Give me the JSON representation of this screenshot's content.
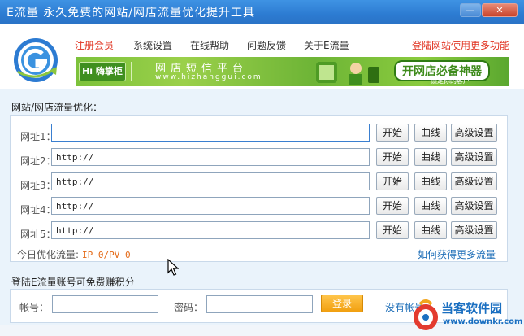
{
  "window": {
    "title": "E流量  永久免费的网站/网店流量优化提升工具",
    "minimize_label": "—",
    "close_label": "✕"
  },
  "menu": {
    "items": [
      "注册会员",
      "系统设置",
      "在线帮助",
      "问题反馈",
      "关于E流量"
    ],
    "right_link": "登陆网站使用更多功能"
  },
  "banner": {
    "logo_text": "Hi 嗨掌柜",
    "title": "网店短信平台",
    "url": "www.hizhanggui.com",
    "tag": "开网店必备神器",
    "tag_sub": "锁定你的客户"
  },
  "optimize": {
    "section_title": "网站/网店流量优化：",
    "rows": [
      {
        "label": "网址1：",
        "value": ""
      },
      {
        "label": "网址2：",
        "value": "http://"
      },
      {
        "label": "网址3：",
        "value": "http://"
      },
      {
        "label": "网址4：",
        "value": "http://"
      },
      {
        "label": "网址5：",
        "value": "http://"
      }
    ],
    "start_label": "开始",
    "curve_label": "曲线",
    "advanced_label": "高级设置",
    "today_label": "今日优化流量:",
    "today_value": "IP 0/PV 0",
    "more_link": "如何获得更多流量"
  },
  "login": {
    "section_title": "登陆E流量账号可免费赚积分",
    "account_label": "帐号：",
    "password_label": "密码：",
    "account_value": "",
    "password_value": "",
    "login_button": "登录",
    "no_account": "没有帐号"
  },
  "watermark": {
    "name": "当客软件园",
    "url": "www.downkr.com"
  },
  "colors": {
    "titlebar": "#2c7bd2",
    "accent_red": "#e0301e",
    "link_blue": "#1f6fb8",
    "value_orange": "#e46a17",
    "login_orange": "#f19f10",
    "banner_green": "#7cc23b"
  }
}
